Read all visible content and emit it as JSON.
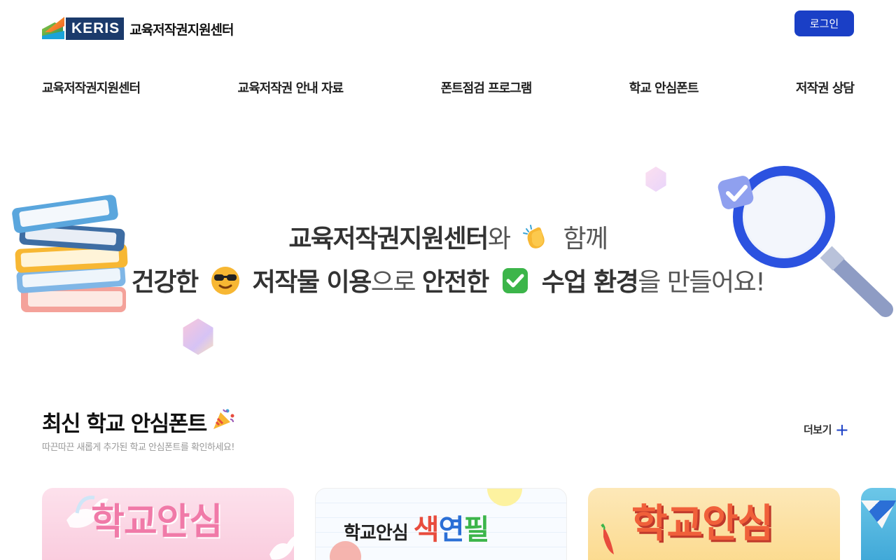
{
  "header": {
    "logo_keris": "KERIS",
    "logo_text": "교육저작권지원센터",
    "login_label": "로그인"
  },
  "nav": {
    "items": [
      {
        "label": "교육저작권지원센터"
      },
      {
        "label": "교육저작권 안내 자료"
      },
      {
        "label": "폰트점검 프로그램"
      },
      {
        "label": "학교 안심폰트"
      },
      {
        "label": "저작권 상담"
      }
    ]
  },
  "hero": {
    "line1_bold": "교육저작권지원센터",
    "line1_a": "와",
    "line1_b": "함께",
    "line2_bold1": "건강한",
    "line2_bold2": "저작물 이용",
    "line2_a": "으로",
    "line2_bold3": "안전한",
    "line2_bold4": "수업 환경",
    "line2_b": "을 만들어요!"
  },
  "section": {
    "title": "최신 학교 안심폰트",
    "subtitle": "따끈따끈 새롭게 추가된 학교 안심폰트를 확인하세요!",
    "more_label": "더보기",
    "more_icon": "+"
  },
  "cards": [
    {
      "title": "학교안심",
      "color": "#f07aa8"
    },
    {
      "title_a": "학교안심",
      "title_b1": "색",
      "title_b2": "연",
      "title_b3": "필"
    },
    {
      "title": "학교안심",
      "color": "#f0603a"
    }
  ],
  "colors": {
    "brand_blue": "#1a3fc6",
    "logo_navy": "#1b3a6b"
  }
}
